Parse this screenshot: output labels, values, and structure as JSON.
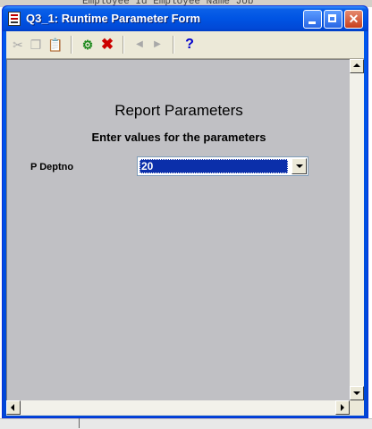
{
  "window": {
    "title": "Q3_1: Runtime Parameter Form",
    "icon": "report-form-icon",
    "controls": {
      "minimize": "minimize-icon",
      "maximize": "maximize-icon",
      "close": "close-icon"
    }
  },
  "background": {
    "visible_text": "Employee Id Employee Name   Job"
  },
  "toolbar": {
    "items": [
      {
        "icon": "cut-icon",
        "glyph": "✂",
        "enabled": false
      },
      {
        "icon": "copy-icon",
        "glyph": "❐",
        "enabled": false
      },
      {
        "icon": "paste-icon",
        "glyph": "📋",
        "enabled": false
      },
      {
        "icon": "run-report-icon",
        "glyph": "⚙",
        "enabled": true
      },
      {
        "icon": "cancel-icon",
        "glyph": "✖",
        "enabled": true
      },
      {
        "icon": "previous-page-icon",
        "glyph": "◀",
        "enabled": false
      },
      {
        "icon": "next-page-icon",
        "glyph": "▶",
        "enabled": false
      },
      {
        "icon": "help-icon",
        "glyph": "?",
        "enabled": true
      }
    ]
  },
  "form": {
    "title": "Report Parameters",
    "subtitle": "Enter values for the parameters",
    "parameters": [
      {
        "label": "P Deptno",
        "value": "20"
      }
    ]
  },
  "colors": {
    "title_bar": "#0054e3",
    "form_background": "#c0c0c4",
    "selected_value": "#0b2faa",
    "cancel_icon": "#cc0000",
    "help_icon": "#0000cc"
  }
}
